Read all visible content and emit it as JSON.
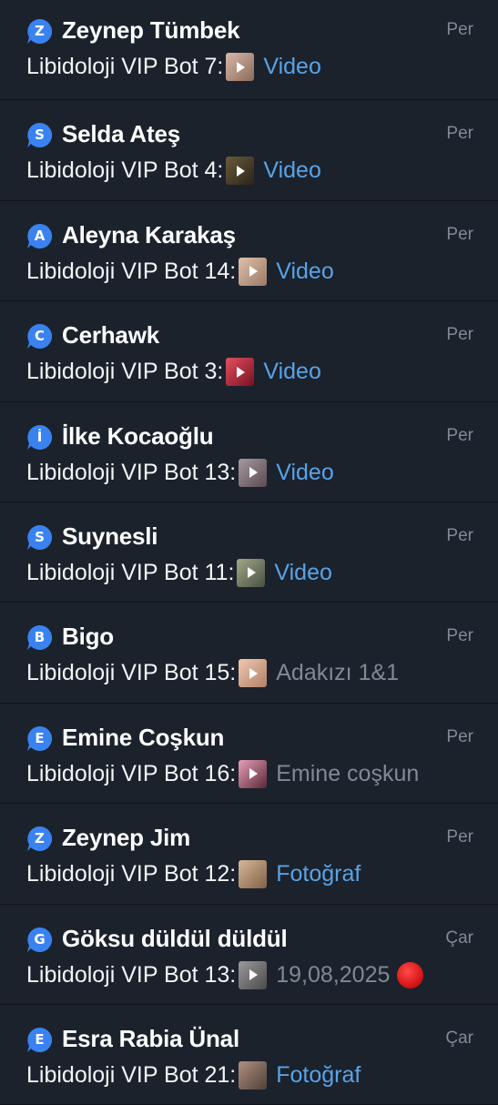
{
  "chats": [
    {
      "initial": "Z",
      "avatar_color": "#3a82f0",
      "name": "Zeynep Tümbek",
      "time": "Per",
      "sender": "Libidoloji VIP Bot 7:",
      "thumb_color": "#b08a7a",
      "media": "Video",
      "media_style": "link"
    },
    {
      "initial": "S",
      "avatar_color": "#3a82f0",
      "name": "Selda Ateş",
      "time": "Per",
      "sender": "Libidoloji VIP Bot 4:",
      "thumb_color": "#4a4030",
      "media": "Video",
      "media_style": "link"
    },
    {
      "initial": "A",
      "avatar_color": "#3a82f0",
      "name": "Aleyna Karakaş",
      "time": "Per",
      "sender": "Libidoloji VIP Bot 14:",
      "thumb_color": "#c8a08a",
      "media": "Video",
      "media_style": "link"
    },
    {
      "initial": "C",
      "avatar_color": "#3a82f0",
      "name": "Cerhawk",
      "time": "Per",
      "sender": "Libidoloji VIP Bot 3:",
      "thumb_color": "#c02838",
      "media": "Video",
      "media_style": "link"
    },
    {
      "initial": "İ",
      "avatar_color": "#3a82f0",
      "name": "İlke Kocaoğlu",
      "time": "Per",
      "sender": "Libidoloji VIP Bot 13:",
      "thumb_color": "#8a7a80",
      "media": "Video",
      "media_style": "link"
    },
    {
      "initial": "S",
      "avatar_color": "#3a82f0",
      "name": "Suynesli",
      "time": "Per",
      "sender": "Libidoloji VIP Bot 11:",
      "thumb_color": "#7a8068",
      "media": "Video",
      "media_style": "link"
    },
    {
      "initial": "B",
      "avatar_color": "#3a82f0",
      "name": "Bigo",
      "time": "Per",
      "sender": "Libidoloji VIP Bot 15:",
      "thumb_color": "#d8a890",
      "media": "Adakızı 1&1",
      "media_style": "gray"
    },
    {
      "initial": "E",
      "avatar_color": "#3a82f0",
      "name": "Emine Coşkun",
      "time": "Per",
      "sender": "Libidoloji VIP Bot 16:",
      "thumb_color": "#c07890",
      "media": "Emine coşkun",
      "media_style": "gray"
    },
    {
      "initial": "Z",
      "avatar_color": "#3a82f0",
      "name": "Zeynep Jim",
      "time": "Per",
      "sender": "Libidoloji VIP Bot 12:",
      "thumb_color": "#b89878",
      "media": "Fotoğraf",
      "media_style": "link"
    },
    {
      "initial": "G",
      "avatar_color": "#3a82f0",
      "name": "Göksu düldül düldül",
      "time": "Çar",
      "sender": "Libidoloji VIP Bot 13:",
      "thumb_color": "#7a7a7a",
      "media": "19,08,2025",
      "media_style": "gray",
      "red_dot": true
    },
    {
      "initial": "E",
      "avatar_color": "#3a82f0",
      "name": "Esra Rabia Ünal",
      "time": "Çar",
      "sender": "Libidoloji VIP Bot 21:",
      "thumb_color": "#8a7060",
      "media": "Fotoğraf",
      "media_style": "link"
    }
  ]
}
